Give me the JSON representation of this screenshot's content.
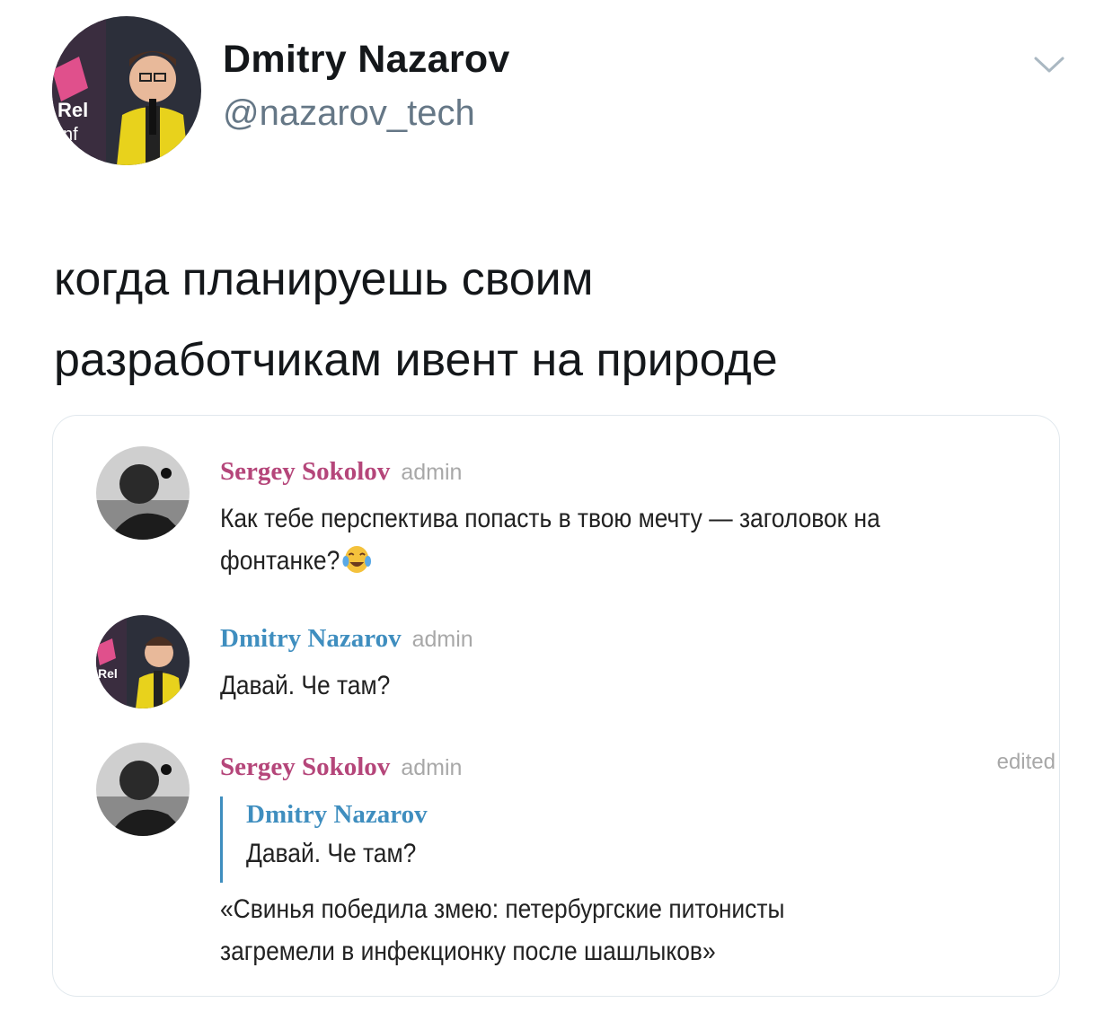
{
  "tweet": {
    "author_name": "Dmitry Nazarov",
    "author_handle": "@nazarov_tech",
    "text_lines": [
      "когда планируешь своим",
      "разработчикам ивент на природе"
    ],
    "menu_icon": "chevron-down-icon"
  },
  "chat": {
    "messages": [
      {
        "sender": "Sergey Sokolov",
        "role": "admin",
        "lines": [
          "Как тебе перспектива попасть в твою мечту — заголовок на",
          "фонтанке?"
        ],
        "emoji": "tears-of-joy-emoji"
      },
      {
        "sender": "Dmitry Nazarov",
        "role": "admin",
        "lines": [
          "Давай. Че там?"
        ]
      },
      {
        "sender": "Sergey Sokolov",
        "role": "admin",
        "edited": "edited",
        "reply_to": {
          "sender": "Dmitry Nazarov",
          "text": "Давай. Че там?"
        },
        "lines": [
          "«Свинья победила змею: петербургские питонисты",
          "загремели в инфекционку после шашлыков»"
        ]
      }
    ]
  },
  "colors": {
    "sokolov_name": "#b5467a",
    "nazarov_name": "#3f8ebf",
    "handle": "#657786",
    "card_border": "#e1e8ed"
  }
}
